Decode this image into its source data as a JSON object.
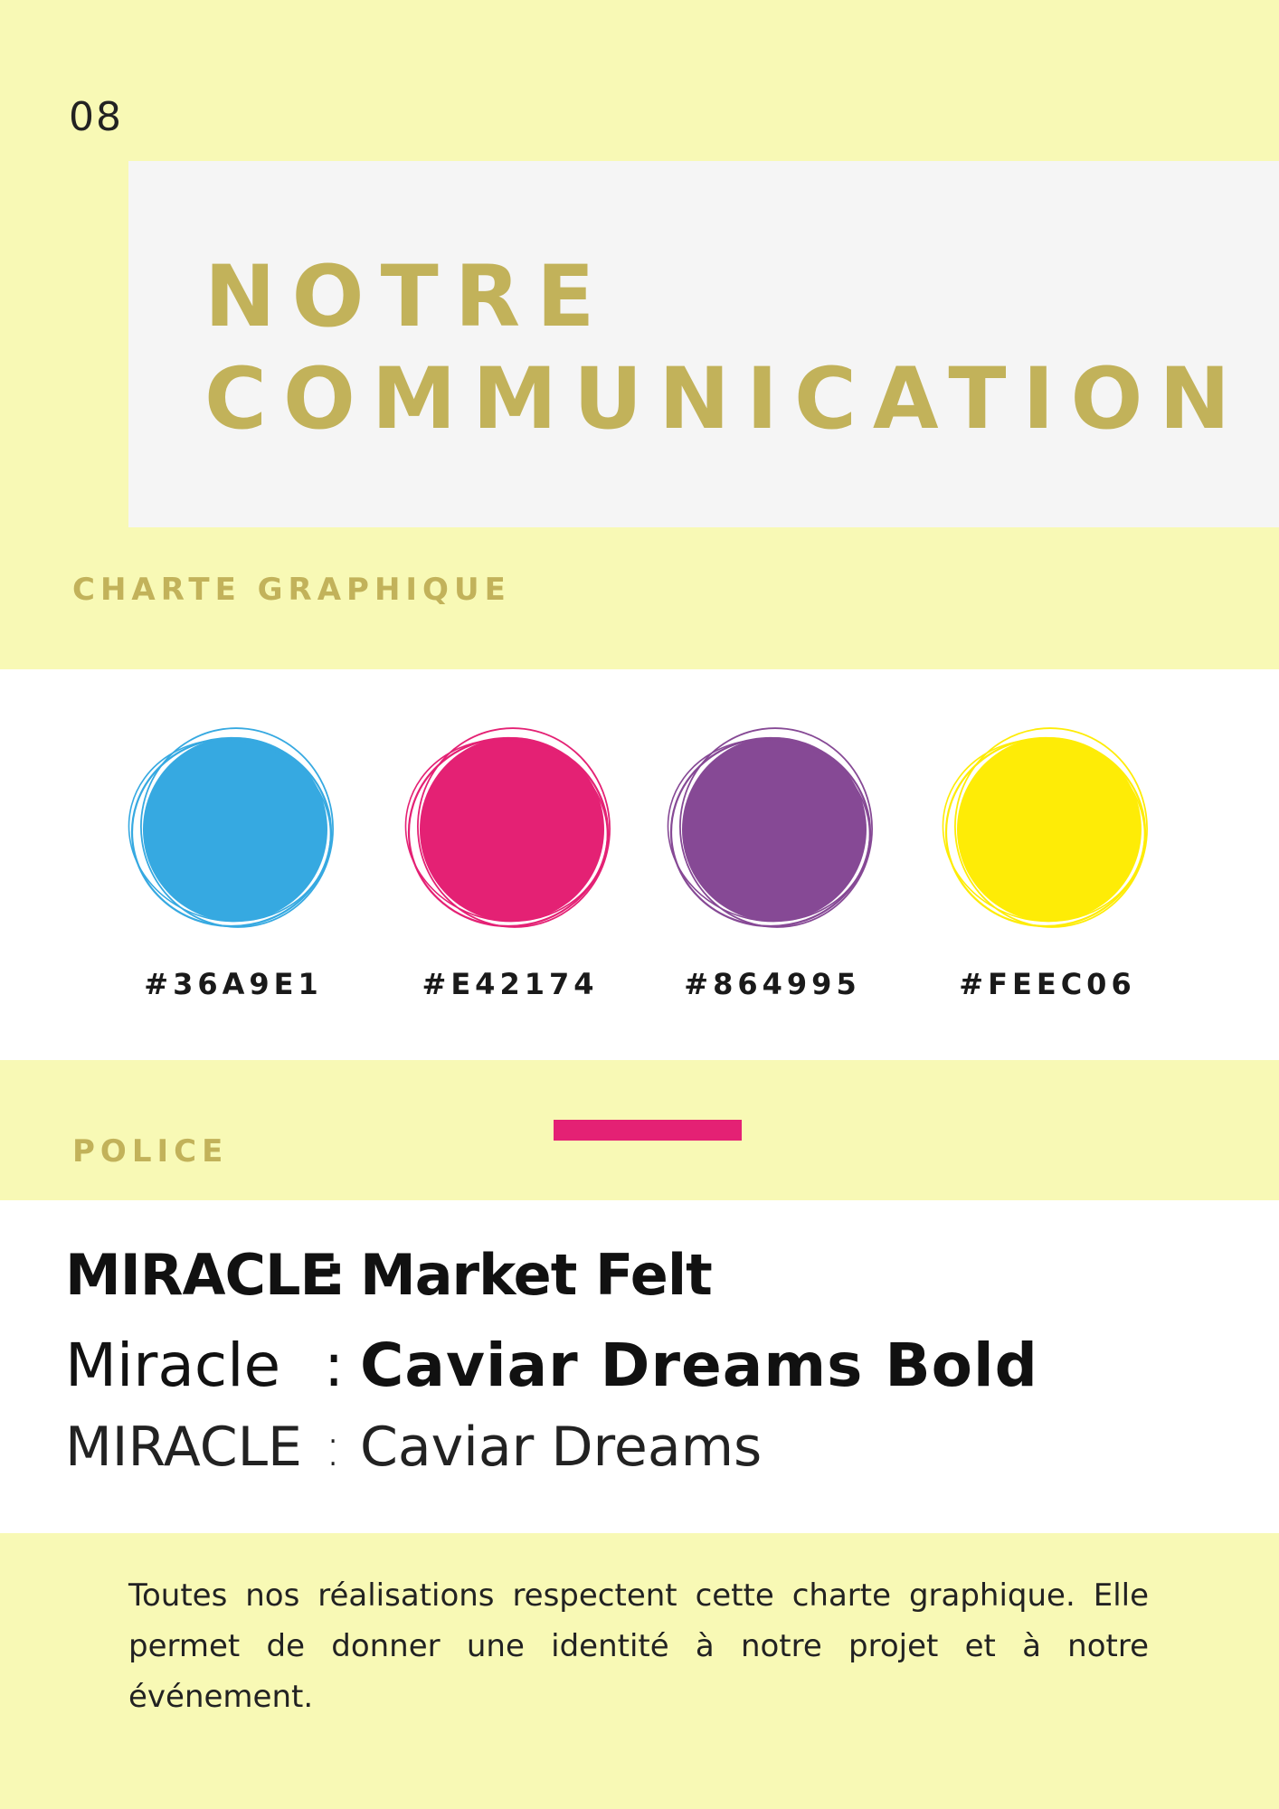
{
  "page": {
    "number": "08",
    "background": "#F8F9B5"
  },
  "title": {
    "line1": "NOTRE",
    "line2": "COMMUNICATION",
    "color": "#C2B25A"
  },
  "charte": {
    "label": "CHARTE GRAPHIQUE",
    "swatches": [
      {
        "code": "#36A9E1",
        "color": "#36A9E1"
      },
      {
        "code": "#E42174",
        "color": "#E42174"
      },
      {
        "code": "#864995",
        "color": "#864995"
      },
      {
        "code": "#FEEC06",
        "color": "#FEEC06"
      }
    ]
  },
  "police": {
    "label": "POLICE",
    "accent_color": "#E42174",
    "fonts": [
      {
        "sample": "MIRACLE",
        "separator": ":",
        "name": "Market Felt"
      },
      {
        "sample": "Miracle",
        "separator": ":",
        "name": "Caviar Dreams Bold"
      },
      {
        "sample": "MIRACLE",
        "separator": ":",
        "name": "Caviar Dreams"
      }
    ]
  },
  "footer": {
    "text": "Toutes nos réalisations respectent cette charte graphique. Elle permet de donner une identité à notre projet et à notre événement."
  }
}
